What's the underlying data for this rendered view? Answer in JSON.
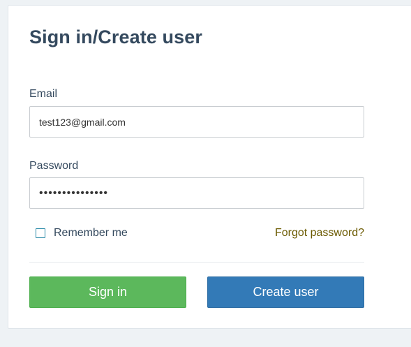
{
  "title": "Sign in/Create user",
  "email": {
    "label": "Email",
    "value": "test123@gmail.com"
  },
  "password": {
    "label": "Password",
    "value": "•••••••••••••••"
  },
  "remember": {
    "label": "Remember me",
    "checked": false
  },
  "forgot_link": "Forgot password?",
  "buttons": {
    "signin": "Sign in",
    "create": "Create user"
  },
  "colors": {
    "signin_button": "#5cb85c",
    "create_button": "#337ab7",
    "title_text": "#34495e",
    "forgot_link": "#6b5a00"
  }
}
